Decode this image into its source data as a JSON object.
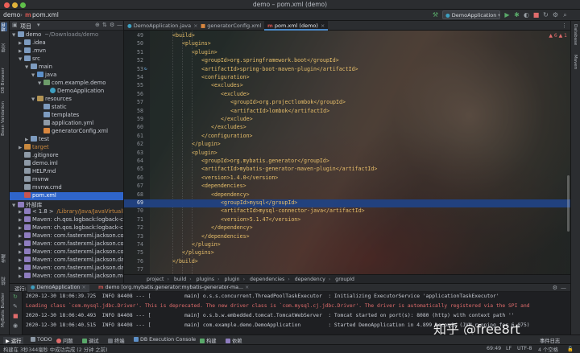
{
  "window": {
    "title": "demo – pom.xml (demo)"
  },
  "navbar": {
    "crumbs": [
      "demo",
      "pom.xml"
    ],
    "run_config": "DemoApplication"
  },
  "left_stripe": {
    "tabs": [
      "项目",
      "提交",
      "DB Browser",
      "Bean Validation",
      "收藏",
      "结构",
      "MyBatis Builder"
    ]
  },
  "right_stripe": {
    "tabs": [
      "Database",
      "Maven"
    ]
  },
  "project_panel": {
    "title": "项目",
    "tree": [
      {
        "label": "demo",
        "hint": "~/Downloads/demo",
        "depth": 0,
        "arrow": "▼",
        "icon": "folder"
      },
      {
        "label": ".idea",
        "depth": 1,
        "arrow": "▶",
        "icon": "folder"
      },
      {
        "label": ".mvn",
        "depth": 1,
        "arrow": "▶",
        "icon": "folder"
      },
      {
        "label": "src",
        "depth": 1,
        "arrow": "▼",
        "icon": "folder"
      },
      {
        "label": "main",
        "depth": 2,
        "arrow": "▼",
        "icon": "folder"
      },
      {
        "label": "java",
        "depth": 3,
        "arrow": "▼",
        "icon": "folder-src"
      },
      {
        "label": "com.example.demo",
        "depth": 4,
        "arrow": "▼",
        "icon": "pkg"
      },
      {
        "label": "DemoApplication",
        "depth": 5,
        "arrow": "",
        "icon": "class"
      },
      {
        "label": "resources",
        "depth": 3,
        "arrow": "▼",
        "icon": "folder-res"
      },
      {
        "label": "static",
        "depth": 4,
        "arrow": "",
        "icon": "folder"
      },
      {
        "label": "templates",
        "depth": 4,
        "arrow": "",
        "icon": "folder"
      },
      {
        "label": "application.yml",
        "depth": 4,
        "arrow": "",
        "icon": "file-g"
      },
      {
        "label": "generatorConfig.xml",
        "depth": 4,
        "arrow": "",
        "icon": "file-x"
      },
      {
        "label": "test",
        "depth": 2,
        "arrow": "▶",
        "icon": "folder"
      },
      {
        "label": "target",
        "depth": 1,
        "arrow": "▶",
        "icon": "folder-orange"
      },
      {
        "label": ".gitignore",
        "depth": 1,
        "arrow": "",
        "icon": "file-g"
      },
      {
        "label": "demo.iml",
        "depth": 1,
        "arrow": "",
        "icon": "file-g"
      },
      {
        "label": "HELP.md",
        "depth": 1,
        "arrow": "",
        "icon": "file-g"
      },
      {
        "label": "mvnw",
        "depth": 1,
        "arrow": "",
        "icon": "file-g"
      },
      {
        "label": "mvnw.cmd",
        "depth": 1,
        "arrow": "",
        "icon": "file-g"
      },
      {
        "label": "pom.xml",
        "depth": 1,
        "arrow": "",
        "icon": "file-m",
        "selected": true
      },
      {
        "label": "外部库",
        "depth": 0,
        "arrow": "▼",
        "icon": "lib"
      },
      {
        "label": "< 1.8 >",
        "hint": "/Library/Java/JavaVirtualMa",
        "depth": 1,
        "arrow": "▶",
        "icon": "lib",
        "orange": true
      },
      {
        "label": "Maven: ch.qos.logback:logback-class",
        "depth": 1,
        "arrow": "▶",
        "icon": "lib"
      },
      {
        "label": "Maven: ch.qos.logback:logback-core",
        "depth": 1,
        "arrow": "▶",
        "icon": "lib"
      },
      {
        "label": "Maven: com.fasterxml.jackson.core:ja",
        "depth": 1,
        "arrow": "▶",
        "icon": "lib"
      },
      {
        "label": "Maven: com.fasterxml.jackson.core:ja",
        "depth": 1,
        "arrow": "▶",
        "icon": "lib"
      },
      {
        "label": "Maven: com.fasterxml.jackson.core:ja",
        "depth": 1,
        "arrow": "▶",
        "icon": "lib"
      },
      {
        "label": "Maven: com.fasterxml.jackson.datatyp",
        "depth": 1,
        "arrow": "▶",
        "icon": "lib"
      },
      {
        "label": "Maven: com.fasterxml.jackson.datatyp",
        "depth": 1,
        "arrow": "▶",
        "icon": "lib"
      },
      {
        "label": "Maven: com.fasterxml.jackson.modul",
        "depth": 1,
        "arrow": "▶",
        "icon": "lib"
      }
    ]
  },
  "editor": {
    "tabs": [
      {
        "label": "DemoApplication.java",
        "active": false
      },
      {
        "label": "generatorConfig.xml",
        "active": false
      },
      {
        "label": "pom.xml (demo)",
        "active": true
      }
    ],
    "error_badge": "▲ 6 ▲ 1",
    "current_line": 69,
    "lines": [
      {
        "n": 49,
        "indent": 2,
        "text": "<build>"
      },
      {
        "n": 50,
        "indent": 3,
        "text": "<plugins>"
      },
      {
        "n": 51,
        "indent": 4,
        "text": "<plugin>"
      },
      {
        "n": 52,
        "indent": 5,
        "text": "<groupId>org.springframework.boot</groupId>"
      },
      {
        "n": 53,
        "indent": 5,
        "text": "<artifactId>spring-boot-maven-plugin</artifactId>",
        "icon": "↻"
      },
      {
        "n": 54,
        "indent": 5,
        "text": "<configuration>"
      },
      {
        "n": 55,
        "indent": 6,
        "text": "<excludes>"
      },
      {
        "n": 56,
        "indent": 7,
        "text": "<exclude>"
      },
      {
        "n": 57,
        "indent": 8,
        "text": "<groupId>org.projectlombok</groupId>"
      },
      {
        "n": 58,
        "indent": 8,
        "text": "<artifactId>lombok</artifactId>"
      },
      {
        "n": 59,
        "indent": 7,
        "text": "</exclude>"
      },
      {
        "n": 60,
        "indent": 6,
        "text": "</excludes>"
      },
      {
        "n": 61,
        "indent": 5,
        "text": "</configuration>"
      },
      {
        "n": 62,
        "indent": 4,
        "text": "</plugin>"
      },
      {
        "n": 63,
        "indent": 4,
        "text": "<plugin>"
      },
      {
        "n": 64,
        "indent": 5,
        "text": "<groupId>org.mybatis.generator</groupId>"
      },
      {
        "n": 65,
        "indent": 5,
        "text": "<artifactId>mybatis-generator-maven-plugin</artifactId>"
      },
      {
        "n": 66,
        "indent": 5,
        "text": "<version>1.4.0</version>"
      },
      {
        "n": 67,
        "indent": 5,
        "text": "<dependencies>"
      },
      {
        "n": 68,
        "indent": 6,
        "text": "<dependency>"
      },
      {
        "n": 69,
        "indent": 7,
        "text": "<groupId>mysql</groupId>"
      },
      {
        "n": 70,
        "indent": 7,
        "text": "<artifactId>mysql-connector-java</artifactId>"
      },
      {
        "n": 71,
        "indent": 7,
        "text": "<version>5.1.47</version>"
      },
      {
        "n": 72,
        "indent": 6,
        "text": "</dependency>"
      },
      {
        "n": 73,
        "indent": 5,
        "text": "</dependencies>"
      },
      {
        "n": 74,
        "indent": 4,
        "text": "</plugin>"
      },
      {
        "n": 75,
        "indent": 3,
        "text": "</plugins>"
      },
      {
        "n": 76,
        "indent": 2,
        "text": "</build>"
      },
      {
        "n": 77,
        "indent": 0,
        "text": ""
      }
    ],
    "breadcrumb": [
      "project",
      "build",
      "plugins",
      "plugin",
      "dependencies",
      "dependency",
      "groupId"
    ]
  },
  "run_panel": {
    "label": "运行:",
    "tabs": [
      "DemoApplication",
      "demo [org.mybatis.generator:mybatis-generator-ma..."
    ],
    "console": [
      {
        "text": "2020-12-30 18:06:39.725  INFO 84408 --- [           main] o.s.s.concurrent.ThreadPoolTaskExecutor  : Initializing ExecutorService 'applicationTaskExecutor'",
        "warn": false
      },
      {
        "text": "Loading class `com.mysql.jdbc.Driver'. This is deprecated. The new driver class is `com.mysql.cj.jdbc.Driver'. The driver is automatically registered via the SPI and",
        "warn": true
      },
      {
        "text": "2020-12-30 18:06:40.493  INFO 84408 --- [           main] o.s.b.w.embedded.tomcat.TomcatWebServer  : Tomcat started on port(s): 8080 (http) with context path ''",
        "warn": false
      },
      {
        "text": "2020-12-30 18:06:40.515  INFO 84408 --- [           main] com.example.demo.DemoApplication         : Started DemoApplication in 4.899 seconds (JVM running for 6.075)",
        "warn": false
      }
    ],
    "watermark": "知乎 @free8rt"
  },
  "bottom_toolbar": {
    "items": [
      "▶ 运行",
      "TODO",
      "问题",
      "调试",
      "终端",
      "DB Execution Console",
      "构建",
      "依赖"
    ],
    "right": "事件日志"
  },
  "status_bar": {
    "message": "构建在 3秒344毫秒 中成功完成 (2 分钟 之前)",
    "position": "69:49",
    "line_sep": "LF",
    "encoding": "UTF-8",
    "indent": "4 个空格"
  }
}
